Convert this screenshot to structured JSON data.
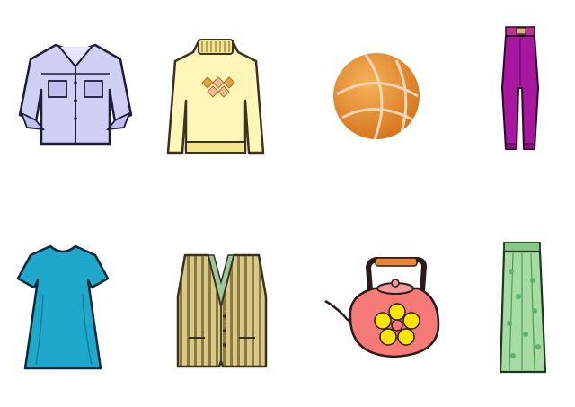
{
  "scene": {
    "background": "#ffffff",
    "layout": "grid-2-rows-4-columns",
    "items": [
      {
        "name": "shirt-icon",
        "color": "#c9c9f0"
      },
      {
        "name": "sweater-icon",
        "color": "#fff4b3"
      },
      {
        "name": "ball-icon",
        "color": "#e8892a"
      },
      {
        "name": "pants-icon",
        "color": "#a3179c"
      },
      {
        "name": "dress-icon",
        "color": "#1aa6c8"
      },
      {
        "name": "vest-icon",
        "color": "#b8a45c"
      },
      {
        "name": "kettle-icon",
        "color": "#f47a7a"
      },
      {
        "name": "skirt-icon",
        "color": "#9ed69a"
      }
    ]
  }
}
